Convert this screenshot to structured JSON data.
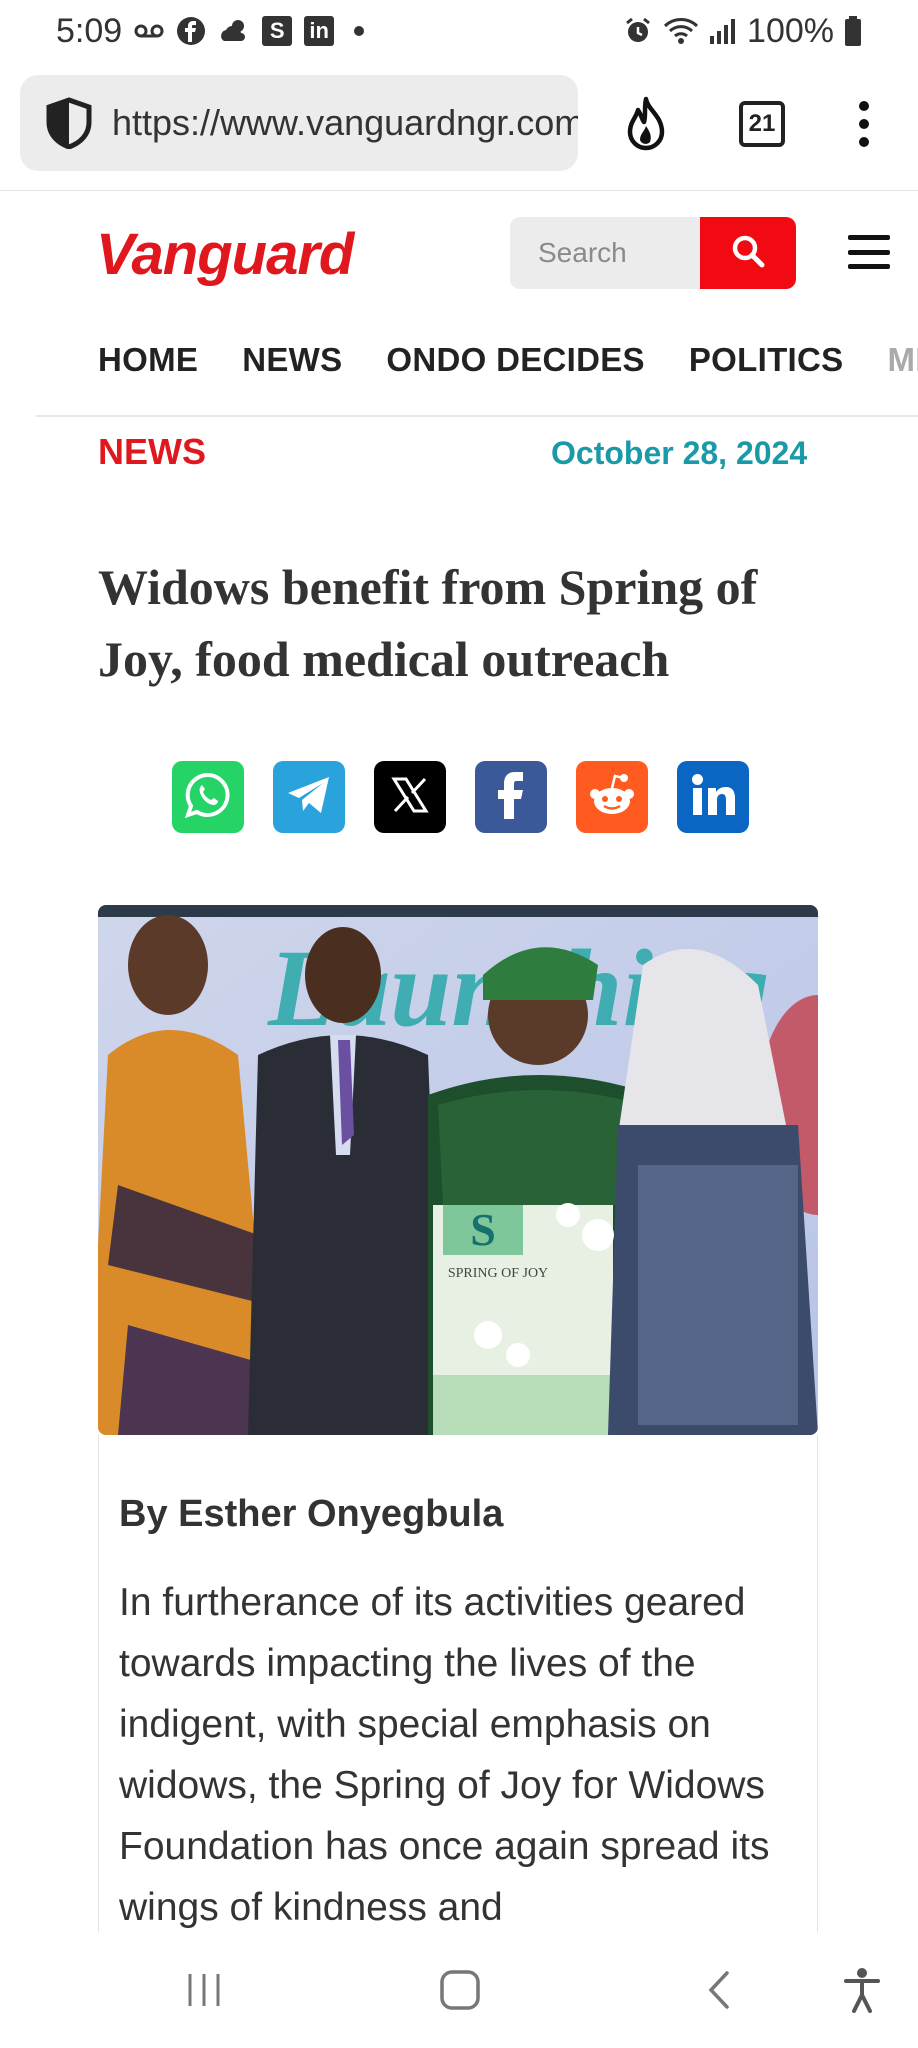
{
  "status_bar": {
    "time": "5:09",
    "battery": "100%",
    "left_icons": [
      "voicemail-icon",
      "facebook-icon",
      "weather-icon",
      "s-app-icon",
      "linkedin-icon",
      "more-dot-icon"
    ],
    "right_icons": [
      "alarm-icon",
      "wifi-icon",
      "signal-icon",
      "battery-icon"
    ],
    "s_label": "S",
    "in_label": "in"
  },
  "browser": {
    "url": "https://www.vanguardngr.com",
    "tab_count": "21",
    "icons": [
      "shield-icon",
      "flame-icon",
      "tabs-icon",
      "more-vert-icon"
    ]
  },
  "site": {
    "logo": "Vanguard",
    "search_placeholder": "Search",
    "nav": [
      "HOME",
      "NEWS",
      "ONDO DECIDES",
      "POLITICS"
    ],
    "nav_partial": "ME",
    "accent": "#e1171e",
    "date_color": "#1a9aa8"
  },
  "article": {
    "category": "NEWS",
    "date": "October 28, 2024",
    "title": "Widows benefit from Spring of Joy, food medical outreach",
    "share": [
      {
        "name": "whatsapp",
        "color": "#25d366"
      },
      {
        "name": "telegram",
        "color": "#2aa3dd"
      },
      {
        "name": "x",
        "color": "#000000"
      },
      {
        "name": "facebook",
        "color": "#3b5998"
      },
      {
        "name": "reddit",
        "color": "#ff5a1f"
      },
      {
        "name": "linkedin",
        "color": "#0a66c2"
      }
    ],
    "image_text": "SPRING OF JOY",
    "image_banner": "Launching",
    "byline": "By Esther Onyegbula",
    "body": "In furtherance of its activities geared towards impacting the lives of the indigent, with special emphasis on widows, the Spring of Joy for Widows Foundation has once again spread its wings of kindness and"
  },
  "system_nav": {
    "icons": [
      "recents-icon",
      "home-icon",
      "back-icon",
      "accessibility-icon"
    ]
  }
}
